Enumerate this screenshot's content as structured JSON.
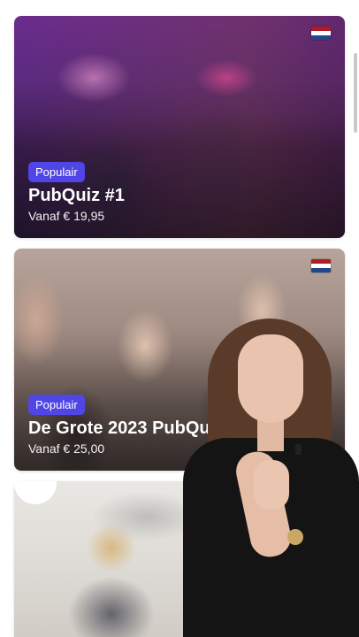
{
  "colors": {
    "badge": "#4f46e5",
    "flag_red": "#ae1c28",
    "flag_white": "#ffffff",
    "flag_blue": "#21468b",
    "scrollbar": "#c9c9c9",
    "page_background": "#ffffff"
  },
  "cards": [
    {
      "flag_icon": "netherlands-flag-icon",
      "badge": "Populair",
      "title": "PubQuiz #1",
      "price": "Vanaf € 19,95"
    },
    {
      "flag_icon": "netherlands-flag-icon",
      "badge": "Populair",
      "title": "De Grote 2023 PubQui",
      "price": "Vanaf € 25,00"
    },
    {
      "flag_icon": null,
      "badge": null,
      "title": null,
      "price": null
    }
  ]
}
